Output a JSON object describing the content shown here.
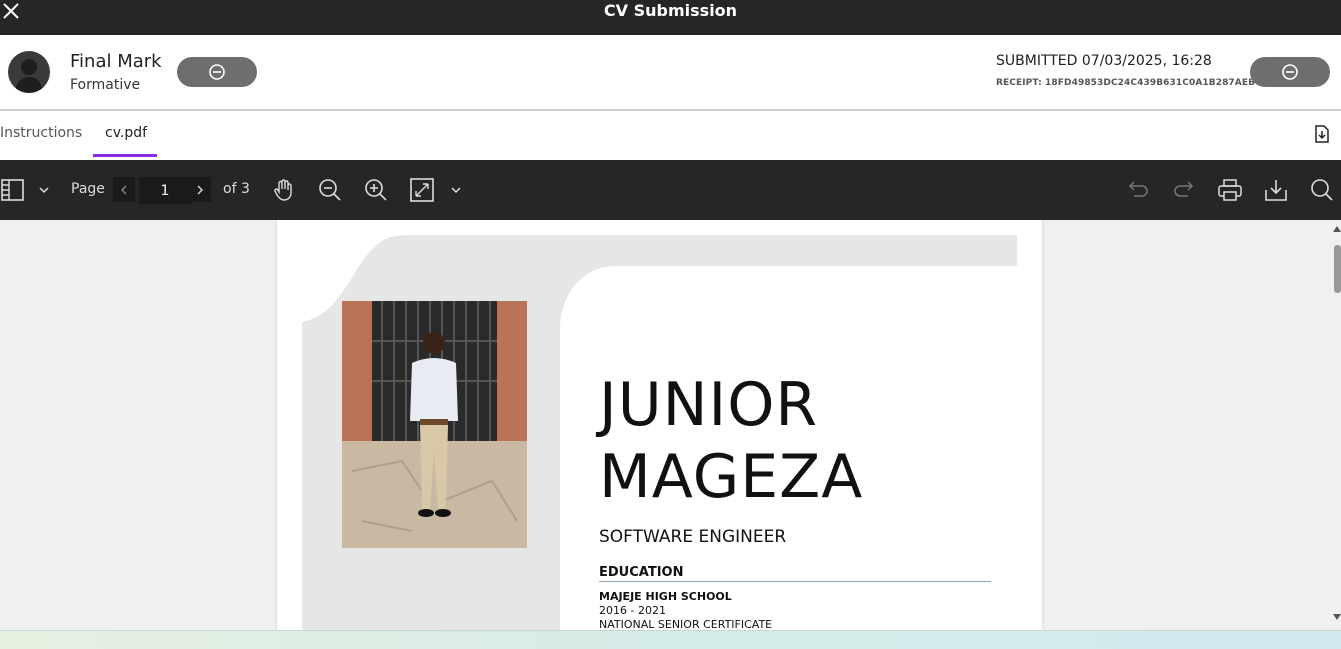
{
  "window": {
    "title": "CV Submission"
  },
  "header": {
    "mark_title": "Final Mark",
    "mark_subtitle": "Formative",
    "submitted": "SUBMITTED 07/03/2025, 16:28",
    "receipt": "RECEIPT: 18FD49853DC24C439B631C0A1B287AEB"
  },
  "tabs": [
    {
      "label": "Instructions",
      "active": false
    },
    {
      "label": "cv.pdf",
      "active": true
    }
  ],
  "toolbar": {
    "page_label": "Page",
    "page_value": "1",
    "page_of": "of 3"
  },
  "document": {
    "first_name": "JUNIOR",
    "last_name": "MAGEZA",
    "role": "SOFTWARE ENGINEER",
    "section_heading": "EDUCATION",
    "school": "MAJEJE HIGH SCHOOL",
    "years": "2016 - 2021",
    "certificate": "NATIONAL SENIOR CERTIFICATE"
  },
  "colors": {
    "titlebar": "#262626",
    "tab_accent": "#8a2be2",
    "pill": "#6e6e6e",
    "toolbar": "#262626"
  }
}
